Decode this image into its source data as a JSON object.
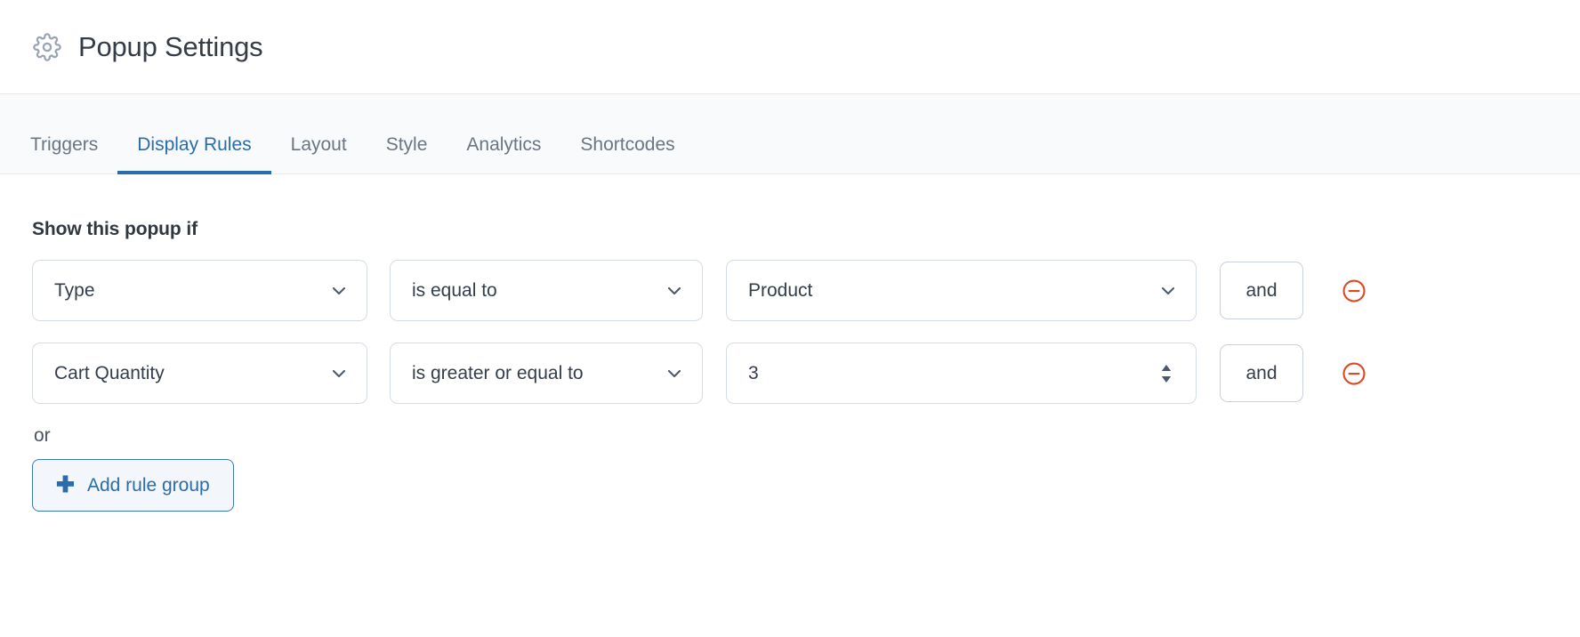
{
  "header": {
    "icon": "gear-icon",
    "title": "Popup Settings"
  },
  "tabs": {
    "items": [
      {
        "label": "Triggers",
        "active": false
      },
      {
        "label": "Display Rules",
        "active": true
      },
      {
        "label": "Layout",
        "active": false
      },
      {
        "label": "Style",
        "active": false
      },
      {
        "label": "Analytics",
        "active": false
      },
      {
        "label": "Shortcodes",
        "active": false
      }
    ],
    "active_color": "#2b6cad"
  },
  "display_rules": {
    "section_title": "Show this popup if",
    "rules": [
      {
        "subject": "Type",
        "operator": "is equal to",
        "value": "Product",
        "value_type": "select",
        "conjunction": "and",
        "remove_icon": "minus-circle-icon"
      },
      {
        "subject": "Cart Quantity",
        "operator": "is greater or equal to",
        "value": "3",
        "value_type": "number",
        "conjunction": "and",
        "remove_icon": "minus-circle-icon"
      }
    ],
    "or_label": "or",
    "add_group_label": "Add rule group",
    "add_group_icon": "plus-icon",
    "remove_color": "#dc4a23",
    "accent_color": "#2b6cad"
  }
}
